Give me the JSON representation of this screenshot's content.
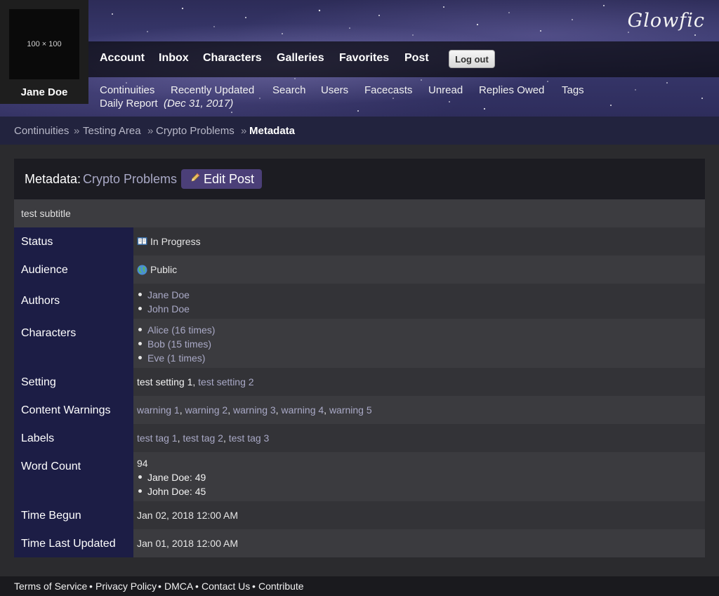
{
  "site": {
    "logo": "Glowfic"
  },
  "user": {
    "name": "Jane Doe",
    "avatar_placeholder": "100 × 100"
  },
  "nav": {
    "items": [
      "Account",
      "Inbox",
      "Characters",
      "Galleries",
      "Favorites",
      "Post"
    ],
    "logout_label": "Log out"
  },
  "subnav": {
    "items": [
      "Continuities",
      "Recently Updated",
      "Search",
      "Users",
      "Facecasts",
      "Unread",
      "Replies Owed",
      "Tags"
    ],
    "daily_report": "Daily Report",
    "daily_report_date": "(Dec 31, 2017)"
  },
  "breadcrumb": {
    "items": [
      "Continuities",
      "Testing Area",
      "Crypto Problems"
    ],
    "current": "Metadata",
    "separator": "»"
  },
  "panel": {
    "title_label": "Metadata:",
    "title_link": "Crypto Problems",
    "edit_label": "Edit Post",
    "subtitle": "test subtitle"
  },
  "metadata": {
    "status": {
      "label": "Status",
      "value": "In Progress",
      "icon": "book-icon"
    },
    "audience": {
      "label": "Audience",
      "value": "Public",
      "icon": "globe-icon"
    },
    "authors": {
      "label": "Authors",
      "items": [
        "Jane Doe",
        "John Doe"
      ]
    },
    "characters": {
      "label": "Characters",
      "items": [
        "Alice (16 times)",
        "Bob (15 times)",
        "Eve (1 times)"
      ]
    },
    "setting": {
      "label": "Setting",
      "items": [
        "test setting 1",
        "test setting 2"
      ]
    },
    "content_warnings": {
      "label": "Content Warnings",
      "items": [
        "warning 1",
        "warning 2",
        "warning 3",
        "warning 4",
        "warning 5"
      ]
    },
    "labels": {
      "label": "Labels",
      "items": [
        "test tag 1",
        "test tag 2",
        "test tag 3"
      ]
    },
    "word_count": {
      "label": "Word Count",
      "total": "94",
      "items": [
        "Jane Doe: 49",
        "John Doe: 45"
      ]
    },
    "time_begun": {
      "label": "Time Begun",
      "value": "Jan 02, 2018 12:00 AM"
    },
    "time_last_updated": {
      "label": "Time Last Updated",
      "value": "Jan 01, 2018 12:00 AM"
    }
  },
  "footer": {
    "items": [
      "Terms of Service",
      "Privacy Policy",
      "DMCA",
      "Contact Us",
      "Contribute"
    ],
    "separator": "•"
  },
  "colors": {
    "label_column": "#1c1d45",
    "link": "#a9a9c6",
    "edit_button": "#4b3f78"
  }
}
